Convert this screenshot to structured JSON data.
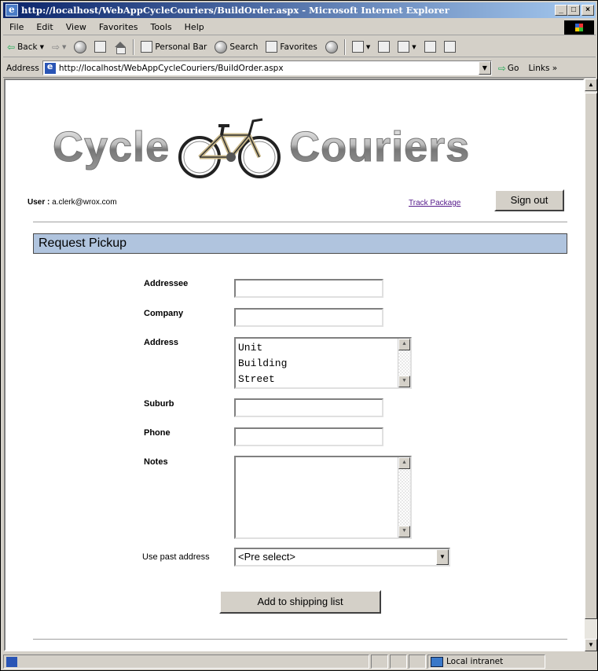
{
  "window": {
    "title": "http://localhost/WebAppCycleCouriers/BuildOrder.aspx - Microsoft Internet Explorer",
    "min_label": "_",
    "max_label": "□",
    "close_label": "×"
  },
  "menu": [
    "File",
    "Edit",
    "View",
    "Favorites",
    "Tools",
    "Help"
  ],
  "toolbar": {
    "back": "Back",
    "personal_bar": "Personal Bar",
    "search": "Search",
    "favorites": "Favorites"
  },
  "address": {
    "label": "Address",
    "url": "http://localhost/WebAppCycleCouriers/BuildOrder.aspx",
    "go": "Go",
    "links": "Links »"
  },
  "logo": {
    "left_word": "Cycle",
    "right_word": "Couriers"
  },
  "user": {
    "label": "User :",
    "email": "a.clerk@wrox.com"
  },
  "links": {
    "track_package": "Track Package"
  },
  "buttons": {
    "sign_out": "Sign out",
    "add_to_shipping": "Add to shipping list"
  },
  "section": {
    "title": "Request Pickup"
  },
  "form": {
    "addressee_label": "Addressee",
    "company_label": "Company",
    "address_label": "Address",
    "address_lines": [
      "Unit",
      "Building",
      "Street"
    ],
    "suburb_label": "Suburb",
    "phone_label": "Phone",
    "notes_label": "Notes",
    "past_address_label": "Use past address",
    "past_address_value": "<Pre select>"
  },
  "status": {
    "zone": "Local intranet"
  }
}
